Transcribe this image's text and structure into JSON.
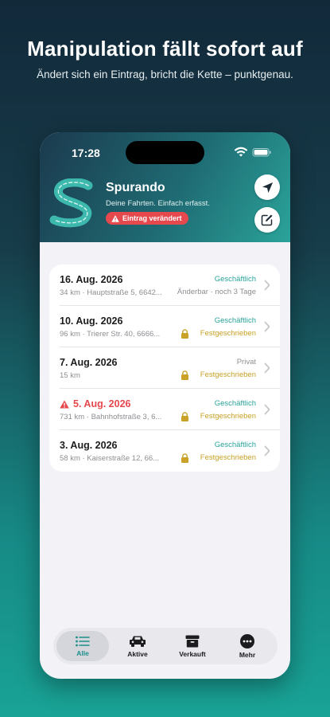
{
  "promo": {
    "headline": "Manipulation fällt sofort auf",
    "subline": "Ändert sich ein Eintrag, bricht die Kette – punktgenau."
  },
  "status_bar": {
    "time": "17:28"
  },
  "app": {
    "name": "Spurando",
    "tagline": "Deine Fahrten. Einfach erfasst.",
    "alert_badge": "Eintrag verändert",
    "buttons": [
      {
        "icon": "location-arrow-icon"
      },
      {
        "icon": "edit-icon"
      }
    ]
  },
  "colors": {
    "business": "#2aa39a",
    "private": "#8e8e93",
    "locked": "#c9a227",
    "alert": "#e5484d",
    "accent": "#1b8f89"
  },
  "trips": [
    {
      "date": "16. Aug. 2026",
      "details": "34 km · Hauptstraße 5, 6642...",
      "category": "Geschäftlich",
      "status": "Änderbar · noch 3 Tage",
      "locked": false,
      "alert": false
    },
    {
      "date": "10. Aug. 2026",
      "details": "96 km · Trierer Str. 40, 6666...",
      "category": "Geschäftlich",
      "status": "Festgeschrieben",
      "locked": true,
      "alert": false
    },
    {
      "date": "7. Aug. 2026",
      "details": "15 km",
      "category": "Privat",
      "status": "Festgeschrieben",
      "locked": true,
      "alert": false
    },
    {
      "date": "5. Aug. 2026",
      "details": "731 km · Bahnhofstraße 3, 6...",
      "category": "Geschäftlich",
      "status": "Festgeschrieben",
      "locked": true,
      "alert": true
    },
    {
      "date": "3. Aug. 2026",
      "details": "58 km · Kaiserstraße 12, 66...",
      "category": "Geschäftlich",
      "status": "Festgeschrieben",
      "locked": true,
      "alert": false
    }
  ],
  "tabs": [
    {
      "label": "Alle",
      "icon": "list-icon",
      "active": true
    },
    {
      "label": "Aktive",
      "icon": "car-icon",
      "active": false
    },
    {
      "label": "Verkauft",
      "icon": "archive-box-icon",
      "active": false
    },
    {
      "label": "Mehr",
      "icon": "more-icon",
      "active": false
    }
  ]
}
